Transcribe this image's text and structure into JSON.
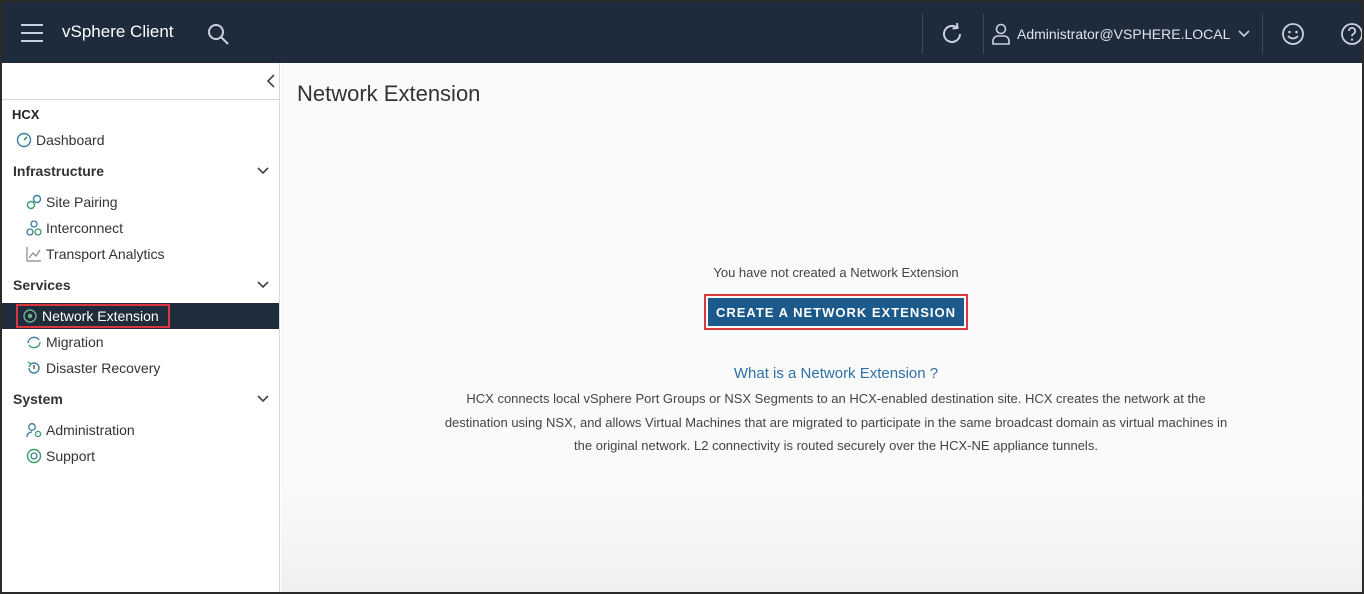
{
  "header": {
    "app_title": "vSphere Client",
    "user_label": "Administrator@VSPHERE.LOCAL",
    "icons": [
      "menu-icon",
      "search-icon",
      "refresh-icon",
      "user-icon",
      "chevron-down-icon",
      "smiley-feedback-icon",
      "help-icon"
    ]
  },
  "sidebar": {
    "root_label": "HCX",
    "dashboard": "Dashboard",
    "sections": [
      {
        "label": "Infrastructure",
        "items": [
          "Site Pairing",
          "Interconnect",
          "Transport Analytics"
        ]
      },
      {
        "label": "Services",
        "items": [
          "Network Extension",
          "Migration",
          "Disaster Recovery"
        ]
      },
      {
        "label": "System",
        "items": [
          "Administration",
          "Support"
        ]
      }
    ],
    "active_item": "Network Extension"
  },
  "main": {
    "title": "Network Extension",
    "empty_message": "You have not created a Network Extension",
    "create_button": "CREATE A NETWORK EXTENSION",
    "what_link": "What is a Network Extension ?",
    "description": [
      "HCX connects local vSphere Port Groups or NSX Segments to an HCX-enabled destination site. HCX creates the network at the",
      "destination using NSX, and allows Virtual Machines that are migrated to participate in the same broadcast domain as virtual machines in",
      "the original network. L2 connectivity is routed securely over the HCX-NE appliance tunnels."
    ]
  },
  "colors": {
    "header_bg": "#1d2b3c",
    "active_bg": "#1f2c3b",
    "primary_button": "#1d5a8c",
    "link": "#2f71a9",
    "highlight_box": "#d9363e"
  }
}
